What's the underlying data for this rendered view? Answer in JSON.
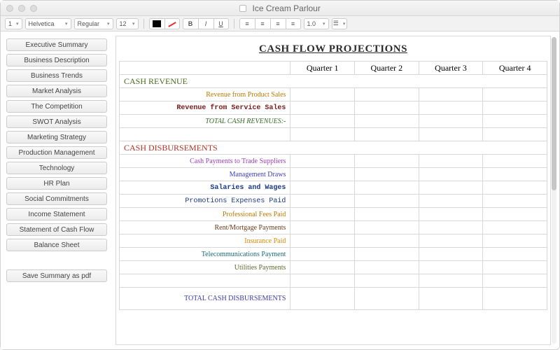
{
  "window": {
    "title": "Ice Cream Parlour"
  },
  "toolbar": {
    "style_level": "1",
    "font": "Helvetica",
    "weight": "Regular",
    "size": "12",
    "line_spacing": "1.0"
  },
  "sidebar": {
    "items": [
      "Executive Summary",
      "Business Description",
      "Business Trends",
      "Market Analysis",
      "The Competition",
      "SWOT Analysis",
      "Marketing Strategy",
      "Production Management",
      "Technology",
      "HR Plan",
      "Social Commitments",
      "Income Statement",
      "Statement of Cash Flow",
      "Balance Sheet"
    ],
    "save_pdf": "Save Summary as pdf"
  },
  "doc": {
    "title": "CASH FLOW PROJECTIONS",
    "quarters": {
      "q1": "Quarter 1",
      "q2": "Quarter 2",
      "q3": "Quarter 3",
      "q4": "Quarter 4"
    },
    "sections": {
      "cash_revenue": "CASH REVENUE",
      "cash_disbursements": "CASH DISBURSEMENTS",
      "total_cash_disbursements": "TOTAL CASH\nDISBURSEMENTS"
    },
    "rows": {
      "revenue_product_sales": "Revenue from Product Sales",
      "revenue_service_sales": "Revenue from Service Sales",
      "total_cash_revenues": "TOTAL CASH REVENUES:-",
      "cash_payments_trade_suppliers": "Cash Payments to Trade Suppliers",
      "management_draws": "Management Draws",
      "salaries_wages": "Salaries and Wages",
      "promotions_expenses_paid": "Promotions Expenses Paid",
      "professional_fees_paid": "Professional Fees Paid",
      "rent_mortgage_payments": "Rent/Mortgage Payments",
      "insurance_paid": "Insurance Paid",
      "telecommunications_payment": "Telecommunications Payment",
      "utilities_payments": "Utilities Payments"
    }
  }
}
